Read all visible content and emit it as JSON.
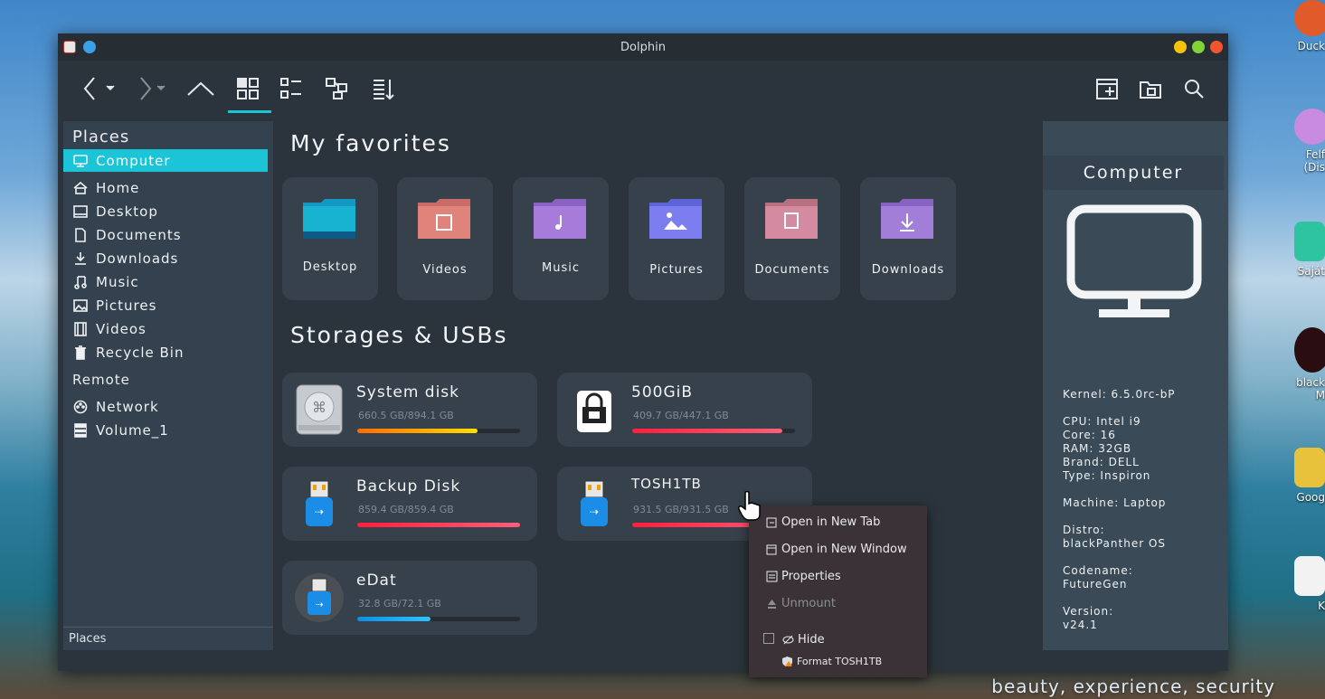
{
  "window": {
    "title": "Dolphin"
  },
  "sidebar": {
    "places_header": "Places",
    "places": [
      {
        "label": "Computer",
        "icon": "monitor-icon",
        "active": true
      },
      {
        "label": "Home",
        "icon": "home-icon"
      },
      {
        "label": "Desktop",
        "icon": "desktop-icon"
      },
      {
        "label": "Documents",
        "icon": "document-icon"
      },
      {
        "label": "Downloads",
        "icon": "download-icon"
      },
      {
        "label": "Music",
        "icon": "music-icon"
      },
      {
        "label": "Pictures",
        "icon": "picture-icon"
      },
      {
        "label": "Videos",
        "icon": "video-icon"
      },
      {
        "label": "Recycle Bin",
        "icon": "trash-icon"
      }
    ],
    "remote_header": "Remote",
    "remote": [
      {
        "label": "Network",
        "icon": "network-icon"
      },
      {
        "label": "Volume_1",
        "icon": "server-icon"
      }
    ],
    "bottom_label": "Places"
  },
  "main": {
    "favorites_title": "My favorites",
    "favorites": [
      {
        "label": "Desktop",
        "color": "#17b3d1"
      },
      {
        "label": "Videos",
        "color": "#e0837b"
      },
      {
        "label": "Music",
        "color": "#a77bd9"
      },
      {
        "label": "Pictures",
        "color": "#7c7ef0"
      },
      {
        "label": "Documents",
        "color": "#d48aa0"
      },
      {
        "label": "Downloads",
        "color": "#a27ed9"
      }
    ],
    "storage_title": "Storages & USBs",
    "storages": [
      {
        "name": "System disk",
        "size": "660.5 GB/894.1 GB",
        "used": 0.74,
        "gradient": "linear-gradient(90deg,#ff6a00,#ffe000)",
        "icon": "hard-disk-icon"
      },
      {
        "name": "500GiB",
        "size": "409.7 GB/447.1 GB",
        "used": 0.92,
        "gradient": "linear-gradient(90deg,#ff1e3c,#ff5f7a)",
        "icon": "locked-drive-icon"
      },
      {
        "name": "Backup Disk",
        "size": "859.4 GB/859.4 GB",
        "used": 1.0,
        "gradient": "linear-gradient(90deg,#ff1e3c,#ff5f7a)",
        "icon": "usb-drive-icon"
      },
      {
        "name": "TOSH1TB",
        "size": "931.5 GB/931.5 GB",
        "used": 1.0,
        "gradient": "linear-gradient(90deg,#ff1e3c,#ff5f7a)",
        "icon": "usb-drive-icon"
      },
      {
        "name": "eDat",
        "size": "32.8 GB/72.1 GB",
        "used": 0.45,
        "gradient": "linear-gradient(90deg,#0a8fe6,#2fc2ff)",
        "icon": "usb-drive-icon"
      }
    ]
  },
  "info": {
    "title": "Computer",
    "kernel": "Kernel: 6.5.0rc-bP",
    "cpu": "CPU: Intel i9",
    "core": "Core: 16",
    "ram": "RAM: 32GB",
    "brand": "Brand: DELL",
    "type": "Type: Inspiron",
    "machine": "Machine: Laptop",
    "distro_label": "Distro:",
    "distro": "blackPanther OS",
    "codename_label": "Codename:",
    "codename": "FutureGen",
    "version_label": "Version:",
    "version": "v24.1"
  },
  "context_menu": {
    "open_new_tab": "Open in New Tab",
    "open_new_window": "Open in New Window",
    "properties": "Properties",
    "unmount": "Unmount",
    "hide": "Hide",
    "format": "Format TOSH1TB"
  },
  "desktop": {
    "icons": [
      "Duck",
      "Felf",
      "(Dis",
      "Saját",
      "black",
      "M",
      "Goog",
      "K"
    ],
    "tagline": "beauty, experience, security"
  }
}
